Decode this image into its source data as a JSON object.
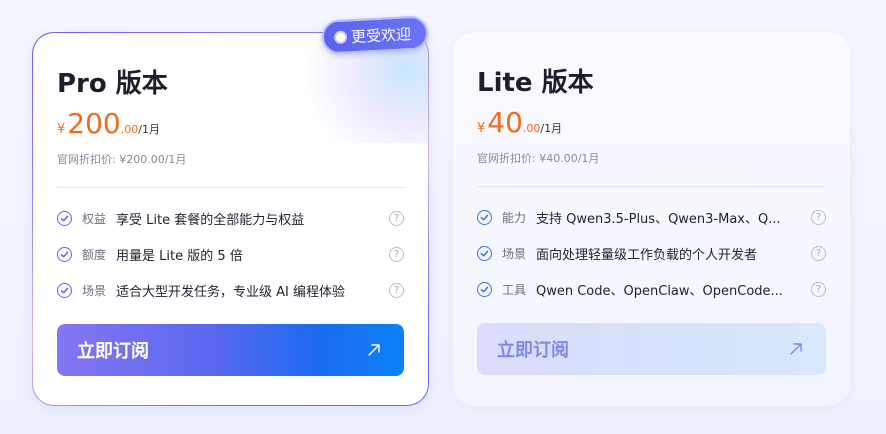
{
  "plans": {
    "pro": {
      "badge": "更受欢迎",
      "title": "Pro 版本",
      "currency": "¥",
      "price_int": "200",
      "price_dec": ".00",
      "period": "/1月",
      "official": "官网折扣价: ¥200.00/1月",
      "features": [
        {
          "key": "权益",
          "value": "享受 Lite 套餐的全部能力与权益"
        },
        {
          "key": "额度",
          "value": "用量是 Lite 版的 5 倍"
        },
        {
          "key": "场景",
          "value": "适合大型开发任务，专业级 AI 编程体验"
        }
      ],
      "cta": "立即订阅",
      "arrow_icon": "arrow-up-right-icon"
    },
    "lite": {
      "title": "Lite 版本",
      "currency": "¥",
      "price_int": "40",
      "price_dec": ".00",
      "period": "/1月",
      "official": "官网折扣价: ¥40.00/1月",
      "features": [
        {
          "key": "能力",
          "value": "支持 Qwen3.5-Plus、Qwen3-Max、Q..."
        },
        {
          "key": "场景",
          "value": "面向处理轻量级工作负载的个人开发者"
        },
        {
          "key": "工具",
          "value": "Qwen Code、OpenClaw、OpenCode..."
        }
      ],
      "cta": "立即订阅",
      "arrow_icon": "arrow-up-right-icon"
    }
  },
  "colors": {
    "price": "#f26a1b",
    "pro_accent": "#6a5cf0",
    "lite_accent": "#2f73e6"
  }
}
